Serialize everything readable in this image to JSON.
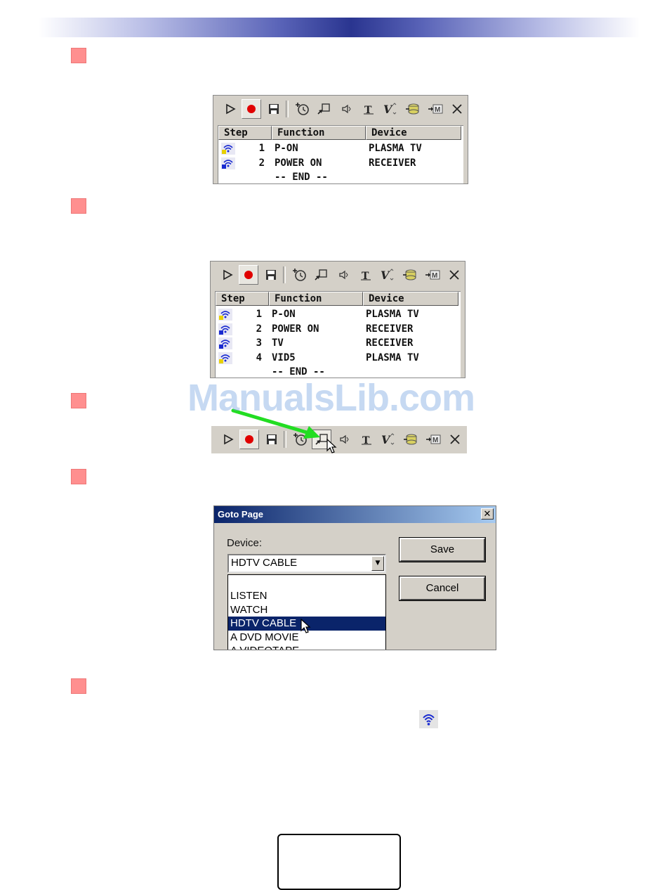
{
  "watermark": "ManualsLib.com",
  "toolbar": {
    "icons": [
      "play-icon",
      "record-icon",
      "save-icon",
      "add-timer-icon",
      "goto-page-icon",
      "mute-icon",
      "text-icon",
      "volume-icon",
      "database-icon",
      "macro-icon",
      "delete-icon"
    ],
    "volume_label": "V"
  },
  "columns": {
    "step": "Step",
    "function": "Function",
    "device": "Device"
  },
  "macro1": {
    "rows": [
      {
        "step": "1",
        "function": "P-ON",
        "device": "PLASMA TV",
        "badge": "P"
      },
      {
        "step": "2",
        "function": "POWER ON",
        "device": "RECEIVER",
        "badge": "R"
      }
    ],
    "end": "-- END --"
  },
  "macro2": {
    "rows": [
      {
        "step": "1",
        "function": "P-ON",
        "device": "PLASMA TV",
        "badge": "P"
      },
      {
        "step": "2",
        "function": "POWER ON",
        "device": "RECEIVER",
        "badge": "R"
      },
      {
        "step": "3",
        "function": "TV",
        "device": "RECEIVER",
        "badge": "R"
      },
      {
        "step": "4",
        "function": "VID5",
        "device": "PLASMA TV",
        "badge": "P"
      }
    ],
    "end": "-- END --"
  },
  "dialog": {
    "title": "Goto Page",
    "close": "✕",
    "device_label": "Device:",
    "device_value": "HDTV CABLE",
    "options": [
      "LISTEN",
      "WATCH",
      "HDTV CABLE",
      "A DVD MOVIE",
      "A VIDEOTAPE"
    ],
    "selected_option": "HDTV CABLE",
    "save": "Save",
    "cancel": "Cancel"
  },
  "colors": {
    "accent": "#0a246a",
    "bullet": "#ff8f8f",
    "record": "#e00000",
    "arrow": "#22dd22"
  }
}
